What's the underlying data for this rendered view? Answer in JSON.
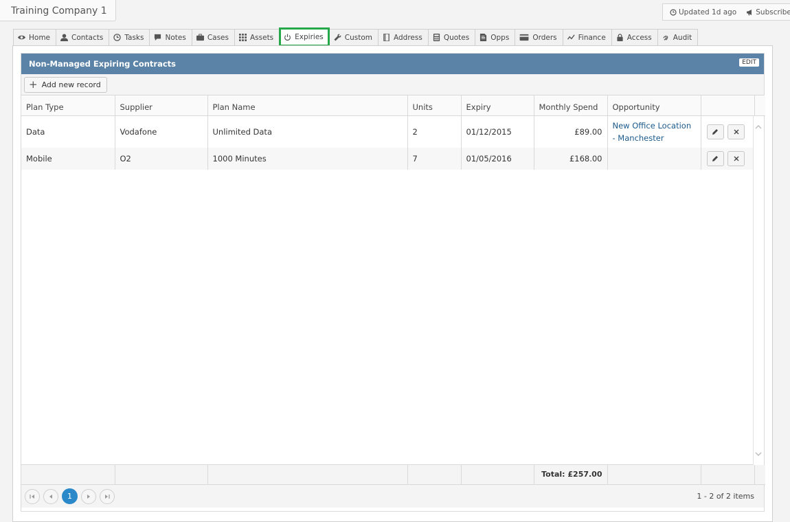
{
  "company": {
    "name": "Training Company 1"
  },
  "header": {
    "updated": "Updated 1d ago",
    "subscribe": "Subscribe"
  },
  "tabs": [
    {
      "label": "Home",
      "icon": "eye-icon"
    },
    {
      "label": "Contacts",
      "icon": "user-icon"
    },
    {
      "label": "Tasks",
      "icon": "clock-icon"
    },
    {
      "label": "Notes",
      "icon": "speech-bubble-icon"
    },
    {
      "label": "Cases",
      "icon": "briefcase-icon"
    },
    {
      "label": "Assets",
      "icon": "grid-icon"
    },
    {
      "label": "Expiries",
      "icon": "power-icon",
      "active": true
    },
    {
      "label": "Custom",
      "icon": "wrench-icon"
    },
    {
      "label": "Address",
      "icon": "book-icon"
    },
    {
      "label": "Quotes",
      "icon": "calculator-icon"
    },
    {
      "label": "Opps",
      "icon": "document-icon"
    },
    {
      "label": "Orders",
      "icon": "credit-card-icon"
    },
    {
      "label": "Finance",
      "icon": "line-chart-icon"
    },
    {
      "label": "Access",
      "icon": "lock-icon"
    },
    {
      "label": "Audit",
      "icon": "fingerprint-icon"
    }
  ],
  "panel": {
    "title": "Non-Managed Expiring Contracts",
    "edit_label": "EDIT",
    "add_label": "Add new record",
    "columns": [
      "Plan Type",
      "Supplier",
      "Plan Name",
      "Units",
      "Expiry",
      "Monthly Spend",
      "Opportunity"
    ],
    "rows": [
      {
        "plan_type": "Data",
        "supplier": "Vodafone",
        "plan_name": "Unlimited Data",
        "units": "2",
        "expiry": "01/12/2015",
        "spend": "£89.00",
        "opportunity": "New Office Location - Manchester"
      },
      {
        "plan_type": "Mobile",
        "supplier": "O2",
        "plan_name": "1000 Minutes",
        "units": "7",
        "expiry": "01/05/2016",
        "spend": "£168.00",
        "opportunity": ""
      }
    ],
    "total": "Total: £257.00",
    "pager": {
      "current_page": "1",
      "info": "1 - 2 of 2 items"
    }
  },
  "colors": {
    "header_blue": "#5b83a7",
    "active_tab_border": "#24a84a",
    "link": "#1b5a8c",
    "page_current": "#2b89c9"
  }
}
